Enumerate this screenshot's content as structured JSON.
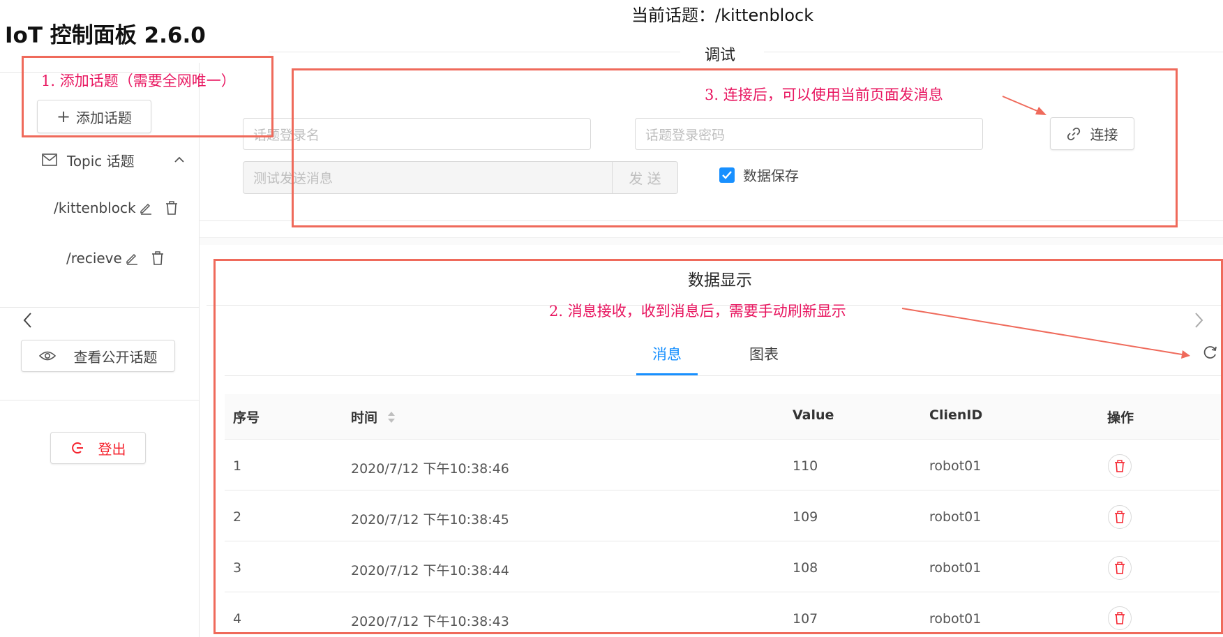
{
  "app": {
    "title": "IoT 控制面板 2.6.0",
    "current_topic": "当前话题：/kittenblock"
  },
  "sidebar": {
    "add_topic_label": "添加话题",
    "topic_menu_label": "Topic 话题",
    "topics": [
      {
        "name": "/kittenblock"
      },
      {
        "name": "/recieve"
      }
    ],
    "view_public_label": "查看公开话题",
    "logout_label": "登出"
  },
  "debug": {
    "section_title": "调试",
    "topic_login_placeholder": "话题登录名",
    "topic_password_placeholder": "话题登录密码",
    "connect_label": "连接",
    "test_message_placeholder": "测试发送消息",
    "send_label": "发 送",
    "save_data_label": "数据保存",
    "save_data_checked": true
  },
  "display": {
    "section_title": "数据显示",
    "tabs": [
      {
        "label": "消息",
        "active": true
      },
      {
        "label": "图表",
        "active": false
      }
    ],
    "table": {
      "headers": {
        "index": "序号",
        "time": "时间",
        "value": "Value",
        "client": "ClienID",
        "action": "操作"
      },
      "rows": [
        {
          "index": "1",
          "time": "2020/7/12 下午10:38:46",
          "value": "110",
          "client": "robot01"
        },
        {
          "index": "2",
          "time": "2020/7/12 下午10:38:45",
          "value": "109",
          "client": "robot01"
        },
        {
          "index": "3",
          "time": "2020/7/12 下午10:38:44",
          "value": "108",
          "client": "robot01"
        },
        {
          "index": "4",
          "time": "2020/7/12 下午10:38:43",
          "value": "107",
          "client": "robot01"
        }
      ]
    }
  },
  "annotations": {
    "note1": "1.  添加话题（需要全网唯一）",
    "note2": "2.  消息接收，收到消息后，需要手动刷新显示",
    "note3": "3.  连接后，可以使用当前页面发消息"
  },
  "colors": {
    "primary": "#1890ff",
    "danger": "#f5222d",
    "annotation": "#ef6a5b",
    "note_text": "#e8155f"
  }
}
